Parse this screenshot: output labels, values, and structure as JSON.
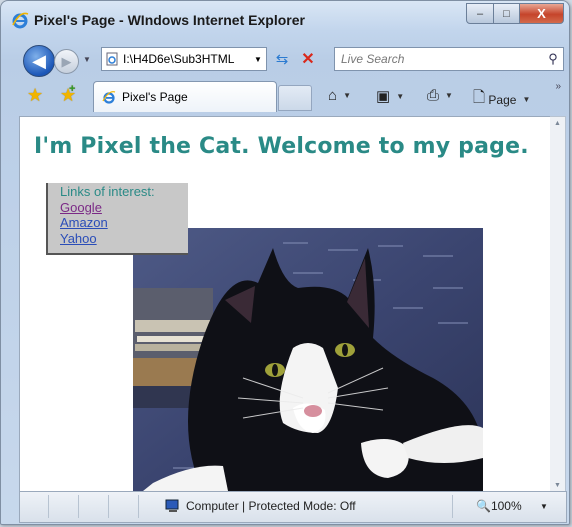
{
  "window": {
    "title": "Pixel's Page - WIndows Internet Explorer",
    "caption_buttons": {
      "minimize": "–",
      "maximize": "□",
      "close": "X"
    }
  },
  "nav": {
    "address": "I:\\H4D6e\\Sub3HTML",
    "search_placeholder": "Live Search",
    "back_icon": "back-arrow-icon",
    "forward_icon": "forward-arrow-icon"
  },
  "tabs": [
    {
      "label": "Pixel's Page"
    }
  ],
  "commandbar": {
    "page_label": "Page"
  },
  "page": {
    "heading": "I'm Pixel the Cat. Welcome to my page.",
    "links_title": "Links of interest:",
    "links": [
      "Google",
      "Amazon",
      "Yahoo"
    ],
    "heading_color": "#2a8a86"
  },
  "status": {
    "zone": "Computer | Protected Mode: Off",
    "zoom": "100%"
  }
}
